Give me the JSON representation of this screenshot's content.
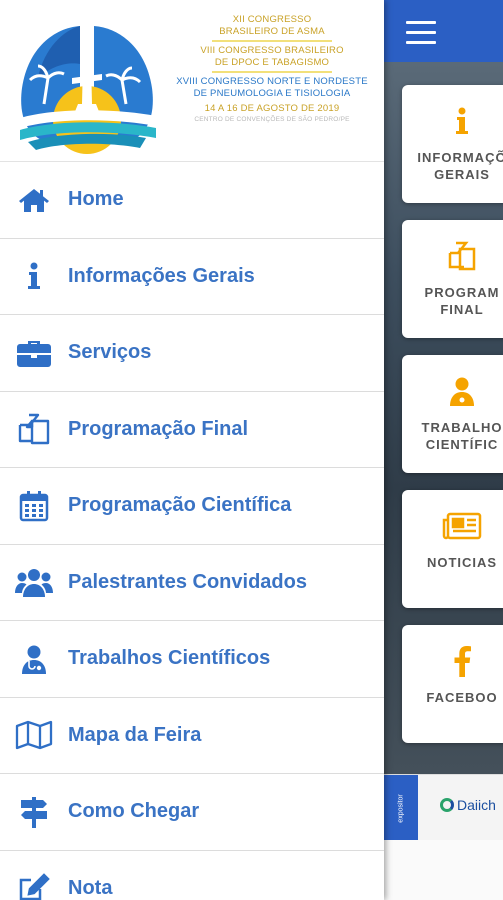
{
  "header": {
    "lines": [
      "XII Congresso",
      "Brasileiro de Asma",
      "VIII Congresso Brasileiro",
      "de DPOC e Tabagismo",
      "XVIII Congresso Norte e Nordeste",
      "de Pneumologia e Tisiologia",
      "14 a 16 de Agosto de 2019"
    ],
    "venue": "Centro de Convenções de São Pedro/PE"
  },
  "menu": {
    "items": [
      {
        "label": "Home",
        "icon": "home-icon"
      },
      {
        "label": "Informações Gerais",
        "icon": "info-icon"
      },
      {
        "label": "Serviços",
        "icon": "briefcase-icon"
      },
      {
        "label": "Programação Final",
        "icon": "copy-icon"
      },
      {
        "label": "Programação Científica",
        "icon": "calendar-icon"
      },
      {
        "label": "Palestrantes Convidados",
        "icon": "users-icon"
      },
      {
        "label": "Trabalhos Científicos",
        "icon": "user-doctor-icon"
      },
      {
        "label": "Mapa da Feira",
        "icon": "map-icon"
      },
      {
        "label": "Como Chegar",
        "icon": "signpost-icon"
      },
      {
        "label": "Nota",
        "icon": "edit-icon"
      }
    ]
  },
  "tiles": [
    {
      "label": "INFORMAÇÕ\nGERAIS",
      "icon": "info-icon"
    },
    {
      "label": "PROGRAM\nFINAL",
      "icon": "copy-icon"
    },
    {
      "label": "TRABALHO\nCIENTÍFIC",
      "icon": "user-doctor-icon"
    },
    {
      "label": "NOTICIAS",
      "icon": "newspaper-icon"
    },
    {
      "label": "FACEBOO",
      "icon": "facebook-icon"
    }
  ],
  "sponsor": {
    "tag": "expositor",
    "name": "Daiich"
  },
  "colors": {
    "accent": "#3a73c4",
    "topbar": "#2b5fc4",
    "tile_icon": "#f5a300"
  }
}
